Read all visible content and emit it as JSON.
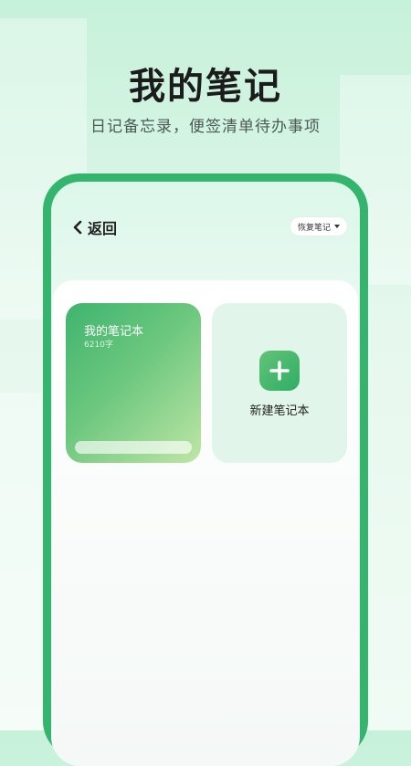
{
  "hero": {
    "title": "我的笔记",
    "subtitle": "日记备忘录，便签清单待办事项"
  },
  "topbar": {
    "back_label": "返回",
    "back_icon": "chevron-left-icon",
    "restore_label": "恢复笔记",
    "restore_icon": "caret-down-icon"
  },
  "notebooks": [
    {
      "title": "我的笔记本",
      "count": "6210字"
    }
  ],
  "new_notebook": {
    "label": "新建笔记本",
    "icon": "plus-icon"
  },
  "colors": {
    "accent": "#34b56d",
    "card_gradient_start": "#3fb46e",
    "card_gradient_end": "#bfe6a6",
    "new_card_bg": "#e1f5ea"
  }
}
